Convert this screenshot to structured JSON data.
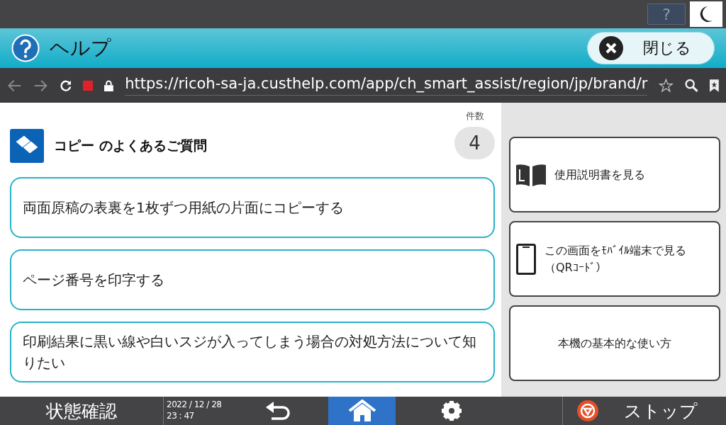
{
  "top_bar": {
    "help_key": "?"
  },
  "header": {
    "title": "ヘルプ",
    "close_button": "閉じる"
  },
  "browser": {
    "url": "https://ricoh-sa-ja.custhelp.com/app/ch_smart_assist/region/jp/brand/r"
  },
  "faq": {
    "title": "コピー のよくあるご質問",
    "count_label": "件数",
    "count": "4",
    "items": [
      {
        "text": "両面原稿の表裏を1枚ずつ用紙の片面にコピーする"
      },
      {
        "text": "ページ番号を印字する"
      },
      {
        "text": "印刷結果に黒い線や白いスジが入ってしまう場合の対処方法について知りたい"
      }
    ]
  },
  "side_buttons": [
    {
      "kind": "book",
      "label": "使用説明書を見る"
    },
    {
      "kind": "phone",
      "label": "この画面をﾓﾊﾞｲﾙ端末で見る（QRｺｰﾄﾞ）"
    },
    {
      "kind": "plain",
      "label": "本機の基本的な使い方"
    }
  ],
  "bottom_bar": {
    "status_button": "状態確認",
    "date": "2022 / 12 / 28",
    "time": "23 : 47",
    "home_selected": true,
    "stop_button": "ストップ"
  }
}
